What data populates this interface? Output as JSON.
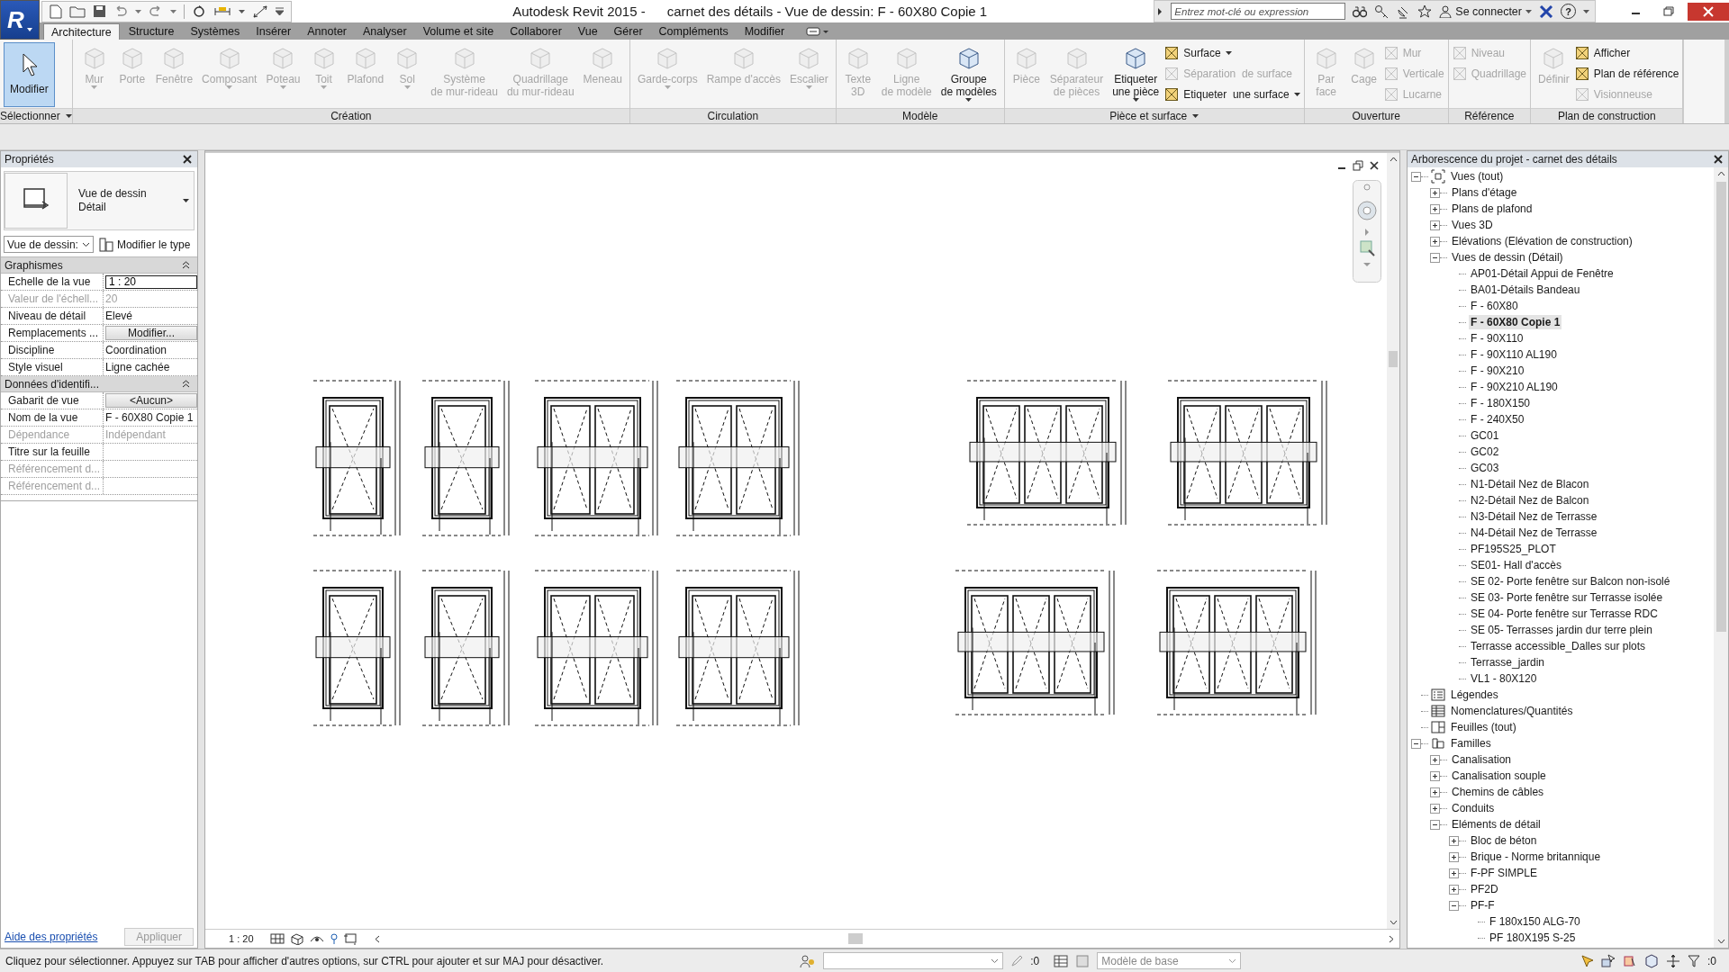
{
  "window": {
    "logo_letter": "R",
    "app_title": "Autodesk Revit 2015 -",
    "document_title": "carnet des détails - Vue de dessin: F - 60X80 Copie 1"
  },
  "infocenter": {
    "placeholder": "Entrez mot-clé ou expression",
    "sign_in": "Se connecter",
    "help": "?"
  },
  "tabs": [
    {
      "label": "Architecture",
      "selected": true
    },
    {
      "label": "Structure",
      "selected": false
    },
    {
      "label": "Systèmes",
      "selected": false
    },
    {
      "label": "Insérer",
      "selected": false
    },
    {
      "label": "Annoter",
      "selected": false
    },
    {
      "label": "Analyser",
      "selected": false
    },
    {
      "label": "Volume et site",
      "selected": false
    },
    {
      "label": "Collaborer",
      "selected": false
    },
    {
      "label": "Vue",
      "selected": false
    },
    {
      "label": "Gérer",
      "selected": false
    },
    {
      "label": "Compléments",
      "selected": false
    },
    {
      "label": "Modifier",
      "selected": false
    }
  ],
  "ribbon": {
    "panels": [
      {
        "title": "Sélectionner",
        "dropdown": true,
        "tools": [
          {
            "label": "Modifier",
            "kind": "select",
            "disabled": false,
            "dropdown": false
          }
        ]
      },
      {
        "title": "Création",
        "dropdown": false,
        "tools": [
          {
            "label": "Mur",
            "kind": "large",
            "disabled": true,
            "dropdown": true
          },
          {
            "label": "Porte",
            "kind": "large",
            "disabled": true,
            "dropdown": false
          },
          {
            "label": "Fenêtre",
            "kind": "large",
            "disabled": true,
            "dropdown": false
          },
          {
            "label": "Composant",
            "kind": "large",
            "disabled": true,
            "dropdown": true
          },
          {
            "label": "Poteau",
            "kind": "large",
            "disabled": true,
            "dropdown": true
          },
          {
            "label": "Toit",
            "kind": "large",
            "disabled": true,
            "dropdown": true
          },
          {
            "label": "Plafond",
            "kind": "large",
            "disabled": true,
            "dropdown": false
          },
          {
            "label": "Sol",
            "kind": "large",
            "disabled": true,
            "dropdown": true
          },
          {
            "label": "Système\nde mur-rideau",
            "kind": "large",
            "disabled": true,
            "dropdown": false
          },
          {
            "label": "Quadrillage\ndu mur-rideau",
            "kind": "large",
            "disabled": true,
            "dropdown": false
          },
          {
            "label": "Meneau",
            "kind": "large",
            "disabled": true,
            "dropdown": false
          }
        ]
      },
      {
        "title": "Circulation",
        "dropdown": false,
        "tools": [
          {
            "label": "Garde-corps",
            "kind": "large",
            "disabled": true,
            "dropdown": true
          },
          {
            "label": "Rampe d'accès",
            "kind": "large",
            "disabled": true,
            "dropdown": false
          },
          {
            "label": "Escalier",
            "kind": "large",
            "disabled": true,
            "dropdown": true
          }
        ]
      },
      {
        "title": "Modèle",
        "dropdown": false,
        "tools": [
          {
            "label": "Texte\n3D",
            "kind": "large",
            "disabled": true,
            "dropdown": false
          },
          {
            "label": "Ligne\nde modèle",
            "kind": "large",
            "disabled": true,
            "dropdown": false
          },
          {
            "label": "Groupe\nde modèles",
            "kind": "large",
            "disabled": false,
            "dropdown": true
          }
        ]
      },
      {
        "title": "Pièce et surface",
        "dropdown": true,
        "tools": [
          {
            "label": "Pièce",
            "kind": "large",
            "disabled": true,
            "dropdown": false
          },
          {
            "label": "Séparateur\nde pièces",
            "kind": "large",
            "disabled": true,
            "dropdown": false
          },
          {
            "label": "Etiqueter\nune pièce",
            "kind": "large",
            "disabled": false,
            "dropdown": true
          },
          {
            "label": "Surface",
            "kind": "small",
            "disabled": false,
            "dropdown": true
          },
          {
            "label": "Séparation  de surface",
            "kind": "small",
            "disabled": true,
            "dropdown": false
          },
          {
            "label": "Etiqueter  une surface",
            "kind": "small",
            "disabled": false,
            "dropdown": true
          }
        ]
      },
      {
        "title": "Ouverture",
        "dropdown": false,
        "tools": [
          {
            "label": "Par\nface",
            "kind": "large",
            "disabled": true,
            "dropdown": false
          },
          {
            "label": "Cage",
            "kind": "large",
            "disabled": true,
            "dropdown": false
          },
          {
            "label": "Mur",
            "kind": "small",
            "disabled": true,
            "dropdown": false
          },
          {
            "label": "Verticale",
            "kind": "small",
            "disabled": true,
            "dropdown": false
          },
          {
            "label": "Lucarne",
            "kind": "small",
            "disabled": true,
            "dropdown": false
          }
        ]
      },
      {
        "title": "Référence",
        "dropdown": false,
        "tools": [
          {
            "label": "Niveau",
            "kind": "small",
            "disabled": true,
            "dropdown": false
          },
          {
            "label": "Quadrillage",
            "kind": "small",
            "disabled": true,
            "dropdown": false
          }
        ]
      },
      {
        "title": "Plan de construction",
        "dropdown": false,
        "tools": [
          {
            "label": "Définir",
            "kind": "large",
            "disabled": true,
            "dropdown": false
          },
          {
            "label": "Afficher",
            "kind": "small",
            "disabled": false,
            "dropdown": false
          },
          {
            "label": "Plan de référence",
            "kind": "small",
            "disabled": false,
            "dropdown": false
          },
          {
            "label": "Visionneuse",
            "kind": "small",
            "disabled": true,
            "dropdown": false
          }
        ]
      }
    ]
  },
  "properties": {
    "title": "Propriétés",
    "type_name": "Vue de dessin",
    "type_sub": "Détail",
    "filter": "Vue de dessin:",
    "edit_type": "Modifier le type",
    "groups": [
      {
        "title": "Graphismes",
        "expanded": true,
        "rows": [
          {
            "name": "Echelle de la vue",
            "value": "1 : 20",
            "kind": "input",
            "disabled": false
          },
          {
            "name": "Valeur de l'échell...",
            "value": "20",
            "kind": "text",
            "disabled": true
          },
          {
            "name": "Niveau de détail",
            "value": "Elevé",
            "kind": "text",
            "disabled": false
          },
          {
            "name": "Remplacements ...",
            "value": "Modifier...",
            "kind": "button",
            "disabled": false
          },
          {
            "name": "Discipline",
            "value": "Coordination",
            "kind": "text",
            "disabled": false
          },
          {
            "name": "Style visuel",
            "value": "Ligne cachée",
            "kind": "text",
            "disabled": false
          }
        ]
      },
      {
        "title": "Données d'identifi...",
        "expanded": true,
        "rows": [
          {
            "name": "Gabarit de vue",
            "value": "<Aucun>",
            "kind": "button",
            "disabled": false
          },
          {
            "name": "Nom de la vue",
            "value": "F - 60X80 Copie 1",
            "kind": "text",
            "disabled": false
          },
          {
            "name": "Dépendance",
            "value": "Indépendant",
            "kind": "text",
            "disabled": true
          },
          {
            "name": "Titre sur la feuille",
            "disabled": false
          },
          {
            "name": "Référencement d...",
            "disabled": true
          },
          {
            "name": "Référencement d...",
            "disabled": true
          }
        ]
      }
    ],
    "help_link": "Aide des propriétés",
    "apply": "Appliquer",
    "apply_disabled": true
  },
  "canvas": {
    "details": [
      {
        "kind": "single"
      },
      {
        "kind": "single"
      },
      {
        "kind": "double"
      },
      {
        "kind": "double"
      },
      {
        "kind": "triple"
      },
      {
        "kind": "triple"
      },
      {
        "kind": "single"
      },
      {
        "kind": "single"
      },
      {
        "kind": "double"
      },
      {
        "kind": "double"
      },
      {
        "kind": "triple"
      },
      {
        "kind": "triple"
      }
    ],
    "scale": "1 : 20"
  },
  "browser": {
    "title": "Arborescence du projet - carnet des détails",
    "tree": [
      {
        "label": "Vues (tout)",
        "kind": "views",
        "expanded": true,
        "selected": false,
        "children": [
          {
            "label": "Plans d'étage",
            "expanded": false,
            "selected": false
          },
          {
            "label": "Plans de plafond",
            "expanded": false,
            "selected": false
          },
          {
            "label": "Vues 3D",
            "expanded": false,
            "selected": false
          },
          {
            "label": "Elévations (Elévation de construction)",
            "expanded": false,
            "selected": false
          },
          {
            "label": "Vues de dessin (Détail)",
            "expanded": true,
            "selected": false,
            "children": [
              {
                "label": "AP01-Détail Appui de Fenêtre",
                "selected": false
              },
              {
                "label": "BA01-Détails Bandeau",
                "selected": false
              },
              {
                "label": "F - 60X80",
                "selected": false
              },
              {
                "label": "F - 60X80 Copie 1",
                "selected": true
              },
              {
                "label": "F - 90X110",
                "selected": false
              },
              {
                "label": "F - 90X110 AL190",
                "selected": false
              },
              {
                "label": "F - 90X210",
                "selected": false
              },
              {
                "label": "F - 90X210 AL190",
                "selected": false
              },
              {
                "label": "F - 180X150",
                "selected": false
              },
              {
                "label": "F - 240X50",
                "selected": false
              },
              {
                "label": "GC01",
                "selected": false
              },
              {
                "label": "GC02",
                "selected": false
              },
              {
                "label": "GC03",
                "selected": false
              },
              {
                "label": "N1-Détail Nez de Blacon",
                "selected": false
              },
              {
                "label": "N2-Détail Nez de Balcon",
                "selected": false
              },
              {
                "label": "N3-Détail Nez de Terrasse",
                "selected": false
              },
              {
                "label": "N4-Détail Nez de Terrasse",
                "selected": false
              },
              {
                "label": "PF195S25_PLOT",
                "selected": false
              },
              {
                "label": "SE01- Hall d'accès",
                "selected": false
              },
              {
                "label": "SE 02- Porte fenêtre sur Balcon non-isolé",
                "selected": false
              },
              {
                "label": "SE 03- Porte fenêtre sur Terrasse isolée",
                "selected": false
              },
              {
                "label": "SE 04- Porte fenêtre sur Terrasse RDC",
                "selected": false
              },
              {
                "label": "SE 05- Terrasses jardin dur terre plein",
                "selected": false
              },
              {
                "label": "Terrasse accessible_Dalles sur plots",
                "selected": false
              },
              {
                "label": "Terrasse_jardin",
                "selected": false
              },
              {
                "label": "VL1 - 80X120",
                "selected": false
              }
            ]
          }
        ]
      },
      {
        "label": "Légendes",
        "kind": "legends",
        "selected": false
      },
      {
        "label": "Nomenclatures/Quantités",
        "kind": "schedules",
        "selected": false
      },
      {
        "label": "Feuilles (tout)",
        "kind": "sheets",
        "selected": false
      },
      {
        "label": "Familles",
        "kind": "families",
        "expanded": true,
        "selected": false,
        "children": [
          {
            "label": "Canalisation",
            "expanded": false,
            "selected": false
          },
          {
            "label": "Canalisation souple",
            "expanded": false,
            "selected": false
          },
          {
            "label": "Chemins de câbles",
            "expanded": false,
            "selected": false
          },
          {
            "label": "Conduits",
            "expanded": false,
            "selected": false
          },
          {
            "label": "Eléments de détail",
            "expanded": true,
            "selected": false,
            "children": [
              {
                "label": "Bloc de béton",
                "expanded": false,
                "selected": false
              },
              {
                "label": "Brique - Norme britannique",
                "expanded": false,
                "selected": false
              },
              {
                "label": "F-PF SIMPLE",
                "expanded": false,
                "selected": false
              },
              {
                "label": "PF2D",
                "expanded": false,
                "selected": false
              },
              {
                "label": "PF-F",
                "expanded": true,
                "selected": false,
                "children": [
                  {
                    "label": "F 180x150 ALG-70",
                    "selected": false
                  },
                  {
                    "label": "PF 180X195 S-25",
                    "selected": false
                  }
                ]
              }
            ]
          }
        ]
      }
    ]
  },
  "status_bar": {
    "message": "Cliquez pour sélectionner. Appuyez sur TAB pour afficher d'autres options, sur CTRL pour ajouter et sur MAJ pour désactiver.",
    "selection_count": ":0",
    "workset": "Modèle de base",
    "filter_count": ":0"
  }
}
